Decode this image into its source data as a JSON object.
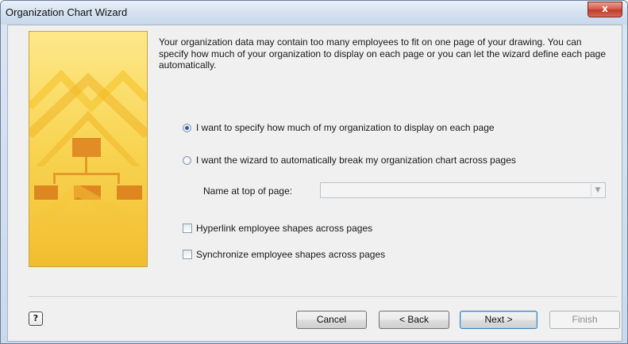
{
  "window": {
    "title": "Organization Chart Wizard",
    "close_label": "x"
  },
  "intro": {
    "text": "Your organization data may contain too many employees to fit on one page of your drawing.  You can specify how much of your organization to display on each page or you can let the wizard define each page automatically."
  },
  "options": {
    "radio_specify": {
      "label": "I want to specify how much of my organization to display on each page",
      "checked": true
    },
    "radio_auto": {
      "label": "I want the wizard to automatically break my organization chart across pages",
      "checked": false
    },
    "name_at_top": {
      "label": "Name at top of page:",
      "value": ""
    },
    "hyperlink": {
      "label": "Hyperlink employee shapes across pages",
      "checked": false
    },
    "synchronize": {
      "label": "Synchronize employee shapes across pages",
      "checked": false
    }
  },
  "buttons": {
    "help": "?",
    "cancel": "Cancel",
    "back": "< Back",
    "next": "Next >",
    "finish": "Finish"
  },
  "colors": {
    "banner_light": "#fde88a",
    "banner_mid": "#f8cc45",
    "banner_dark": "#e08a1f",
    "accent": "#2a5aa8"
  },
  "icons": {
    "help": "help-icon",
    "close": "close-icon",
    "dropdown": "chevron-down-icon"
  }
}
